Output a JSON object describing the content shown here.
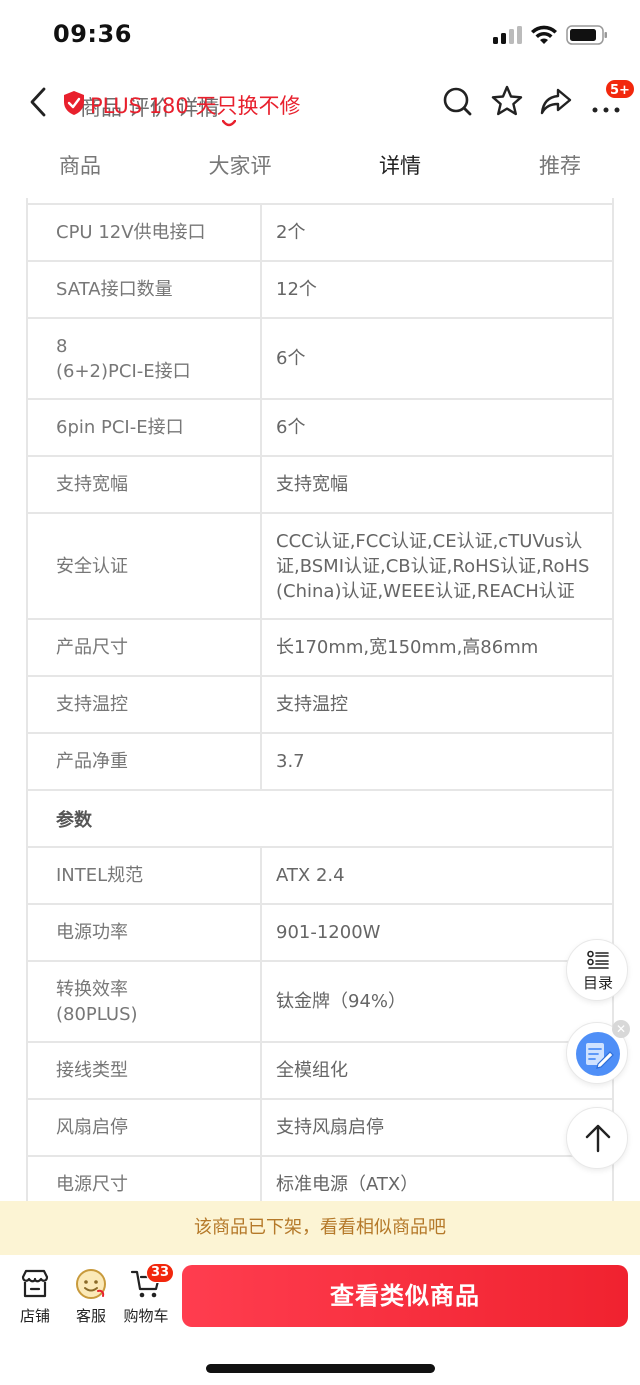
{
  "status_bar": {
    "time": "09:36"
  },
  "nav": {
    "faded_title": "商品  评价  详情",
    "plus_text": "PLUS 180 天只换不修",
    "more_badge": "5+"
  },
  "tabs": [
    {
      "label": "商品"
    },
    {
      "label": "大家评"
    },
    {
      "label": "详情"
    },
    {
      "label": "推荐"
    }
  ],
  "spec_rows": [
    {
      "type": "kv",
      "key": "CPU 12V供电接口",
      "value": "2个"
    },
    {
      "type": "kv",
      "key": "SATA接口数量",
      "value": "12个"
    },
    {
      "type": "kv",
      "key": "8\n(6+2)PCI-E接口",
      "value": "6个"
    },
    {
      "type": "kv",
      "key": "6pin PCI-E接口",
      "value": "6个"
    },
    {
      "type": "kv",
      "key": "支持宽幅",
      "value": "支持宽幅"
    },
    {
      "type": "kv",
      "key": "安全认证",
      "value": "CCC认证,FCC认证,CE认证,cTUVus认证,BSMI认证,CB认证,RoHS认证,RoHS(China)认证,WEEE认证,REACH认证"
    },
    {
      "type": "kv",
      "key": "产品尺寸",
      "value": "长170mm,宽150mm,高86mm"
    },
    {
      "type": "kv",
      "key": "支持温控",
      "value": "支持温控"
    },
    {
      "type": "kv",
      "key": "产品净重",
      "value": "3.7"
    },
    {
      "type": "section",
      "label": "参数"
    },
    {
      "type": "kv",
      "key": "INTEL规范",
      "value": "ATX 2.4"
    },
    {
      "type": "kv",
      "key": "电源功率",
      "value": "901-1200W"
    },
    {
      "type": "kv",
      "key": "转换效率\n(80PLUS)",
      "value": "钛金牌（94%）"
    },
    {
      "type": "kv",
      "key": "接线类型",
      "value": "全模组化"
    },
    {
      "type": "kv",
      "key": "风扇启停",
      "value": "支持风扇启停"
    },
    {
      "type": "kv",
      "key": "电源尺寸",
      "value": "标准电源（ATX）"
    }
  ],
  "floating": {
    "toc_label": "目录"
  },
  "offshelf_notice": "该商品已下架，看看相似商品吧",
  "bottom_bar": {
    "shop_label": "店铺",
    "service_label": "客服",
    "cart_label": "购物车",
    "cart_count": "33",
    "cta_label": "查看类似商品"
  },
  "colors": {
    "accent_red": "#f0222f",
    "plus_red": "#e8202d",
    "notice_bg": "#fcf4d4",
    "notice_text": "#b5792a"
  }
}
